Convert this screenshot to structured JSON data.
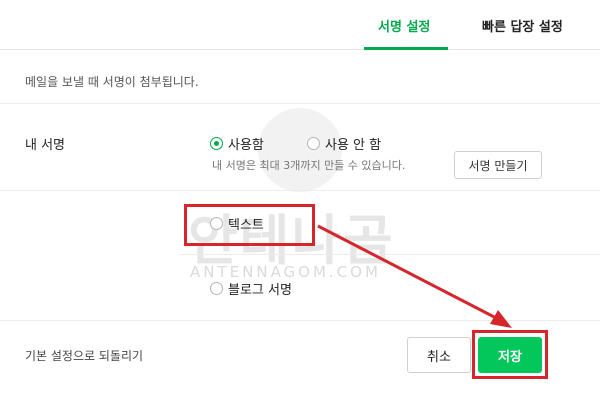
{
  "tabs": [
    {
      "label": "서명 설정",
      "active": true
    },
    {
      "label": "빠른 답장 설정",
      "active": false
    }
  ],
  "description": "메일을 보낼 때 서명이 첨부됩니다.",
  "signature": {
    "row_label": "내 서명",
    "options": [
      {
        "label": "사용함",
        "selected": true
      },
      {
        "label": "사용 안 함",
        "selected": false
      }
    ],
    "hint": "내 서명은 최대 3개까지 만들 수 있습니다.",
    "make_button": "서명 만들기",
    "types": [
      {
        "label": "텍스트",
        "selected": false
      },
      {
        "label": "블로그 서명",
        "selected": false
      }
    ]
  },
  "watermark": {
    "text": "안테나곰",
    "url": "ANTENNAGOM.COM"
  },
  "footer": {
    "reset_label": "기본 설정으로 되돌리기",
    "cancel_label": "취소",
    "save_label": "저장"
  },
  "colors": {
    "accent": "#03c75a",
    "accent_text": "#03a94d",
    "annotation": "#d7262b"
  }
}
